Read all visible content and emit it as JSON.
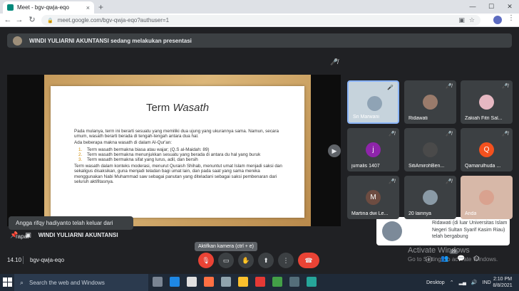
{
  "browser": {
    "tab_title": "Meet - bgv-qwja-eqo",
    "tab_close": "×",
    "new_tab": "+",
    "url": "meet.google.com/bgv-qwja-eqo?authuser=1"
  },
  "banner": {
    "text": "WINDI YULIARNI AKUNTANSI sedang melakukan presentasi"
  },
  "slide": {
    "title_plain": "Term ",
    "title_italic": "Wasath",
    "p1": "Pada mulanya, term ini berarti sesuatu yang memiliki dua ujung yang ukurannya sama. Namun, secara umum, wasath berarti berada di tengah-tengah antara dua hal.",
    "p2": "Ada beberapa makna wasath di dalam Al-Qur'an:",
    "items": [
      {
        "num": "1.",
        "text": "Term wasath bermakna biasa atau wajar; (Q.S al-Maidah: 89)"
      },
      {
        "num": "2.",
        "text": "Term wasath bermakna menunjukkan sesuatu yang berada di antara du hal yang buruk"
      },
      {
        "num": "3.",
        "text": "Term wasath bermakna sifat yang lurus, adil, dan bersih"
      }
    ],
    "p3": "Term wasath dalam konteks moderasi, menurut Quraish Shihab, menuntut umat Islam menjadi saksi dan sekaligus disaksikan, guna menjadi teladan bagi umat lain, dan pada saat yang sama mereka menggunakan Nabi Muhammad saw sebagai panutan yang diteladani sebagai saksi pembenaran dari seluruh aktifitasnya."
  },
  "participants": [
    {
      "name": "Sri Marwani",
      "initial": "",
      "color": "#8fa3b5",
      "photo": true
    },
    {
      "name": "Ridawati",
      "initial": "",
      "color": "#9a7b6b",
      "photo": true
    },
    {
      "name": "Zakiah Fitri Sal...",
      "initial": "",
      "color": "#e6b8c2",
      "photo": true
    },
    {
      "name": "jurnalis 1407",
      "initial": "j",
      "color": "#8e24aa",
      "photo": false
    },
    {
      "name": "SitiAmirohBen...",
      "initial": "",
      "color": "#4a4a4a",
      "photo": true
    },
    {
      "name": "Qamarulhuda ...",
      "initial": "Q",
      "color": "#f4511e",
      "photo": false
    },
    {
      "name": "Martina dwi Le...",
      "initial": "M",
      "color": "#6d4c41",
      "photo": false
    },
    {
      "name": "20 lainnya",
      "initial": "",
      "color": "#8a9aa6",
      "photo": true
    },
    {
      "name": "Anda",
      "initial": "",
      "color": "#d9a28f",
      "photo": true
    }
  ],
  "left_note": "Angga rifqy hadiyanto telah keluar dari rapat",
  "presenter_name": "WINDI YULIARNI AKUNTANSI",
  "notification": "Ridawati (di luar Universitas Islam Negeri Sultan Syarif Kasim Riau) telah bergabung",
  "tooltip": "Aktifkan kamera (ctrl + e)",
  "meeting": {
    "time": "14.10",
    "code": "bgv-qwja-eqo",
    "people_count": "29"
  },
  "watermark": {
    "line1": "Activate Windows",
    "line2": "Go to Settings to activate Windows."
  },
  "taskbar": {
    "search_placeholder": "Search the web and Windows",
    "desktop_label": "Desktop",
    "lang": "IND",
    "time": "2:10 PM",
    "date": "8/8/2021"
  }
}
